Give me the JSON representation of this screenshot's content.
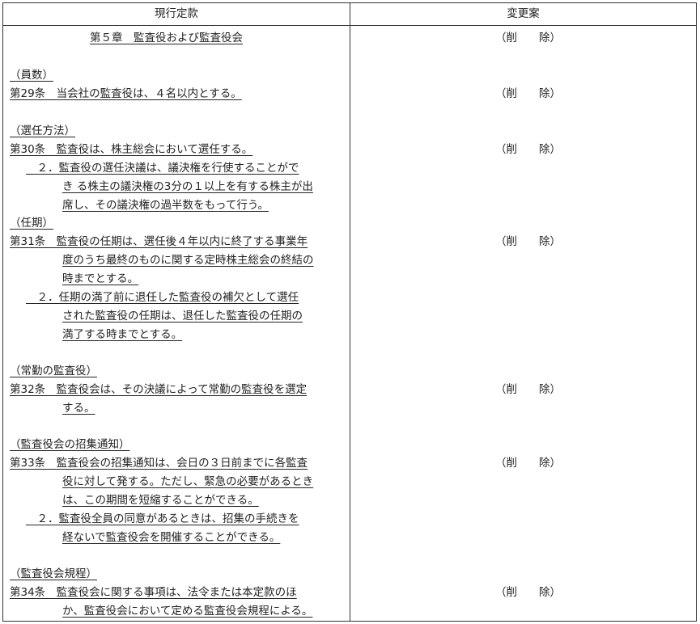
{
  "table": {
    "header_current": "現行定款",
    "header_proposed": "変更案"
  },
  "chapter": "第５章　監査役および監査役会",
  "deleted_label": "（削　　除）",
  "articles": [
    {
      "heading": "（員数）",
      "lines": [
        "第29条　当会社の監査役は、４名以内とする。"
      ]
    },
    {
      "heading": "（選任方法）",
      "lines": [
        "第30条　監査役は、株主総会において選任する。",
        "　２．監査役の選任決議は、議決権を行使することがで",
        "き る株主の議決権の3分の１以上を有する株主が出",
        "席し、その議決権の過半数をもって行う。"
      ]
    },
    {
      "heading": "（任期）",
      "lines": [
        "第31条　監査役の任期は、選任後４年以内に終了する事業年",
        "度のうち最終のものに関する定時株主総会の終結の",
        "時までとする。",
        "　２．任期の満了前に退任した監査役の補欠として選任",
        "された監査役の任期は、退任した監査役の任期の",
        "満了する時までとする。"
      ]
    },
    {
      "heading": "（常勤の監査役）",
      "lines": [
        "第32条　監査役会は、その決議によって常勤の監査役を選定",
        "する。"
      ]
    },
    {
      "heading": "（監査役会の招集通知）",
      "lines": [
        "第33条　監査役会の招集通知は、会日の３日前までに各監査",
        "役に対して発する。ただし、緊急の必要があるとき",
        "は、この期間を短縮することができる。",
        "　２．監査役全員の同意があるときは、招集の手続きを",
        "経ないで監査役会を開催することができる。"
      ]
    },
    {
      "heading": "（監査役会規程）",
      "lines": [
        "第34条　監査役会に関する事項は、法令または本定款のほ",
        "か、監査役会において定める監査役会規程による。"
      ]
    }
  ]
}
